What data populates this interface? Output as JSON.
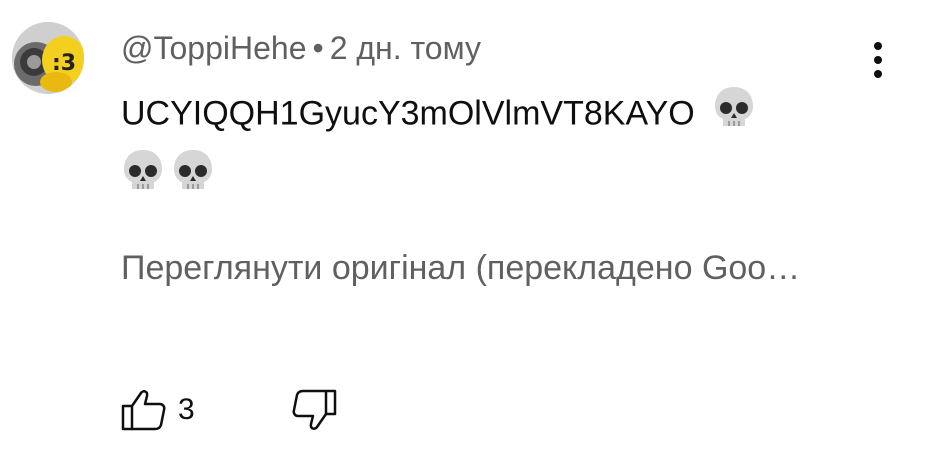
{
  "comment": {
    "author": "@ToppiHehe",
    "separator": "•",
    "time": "2 дн. тому",
    "text": "UCYIQQH1GyucY3mOlVlmVT8KAYO",
    "translate_link": "Переглянути оригінал (перекладено Goo…",
    "like_count": "3"
  },
  "icons": {
    "avatar": "avatar-image",
    "menu": "more-vert-icon",
    "skull": "skull-emoji",
    "like": "thumb-up-icon",
    "dislike": "thumb-down-icon"
  },
  "colors": {
    "text_primary": "#0f0f0f",
    "text_secondary": "#606060",
    "background": "#ffffff"
  }
}
